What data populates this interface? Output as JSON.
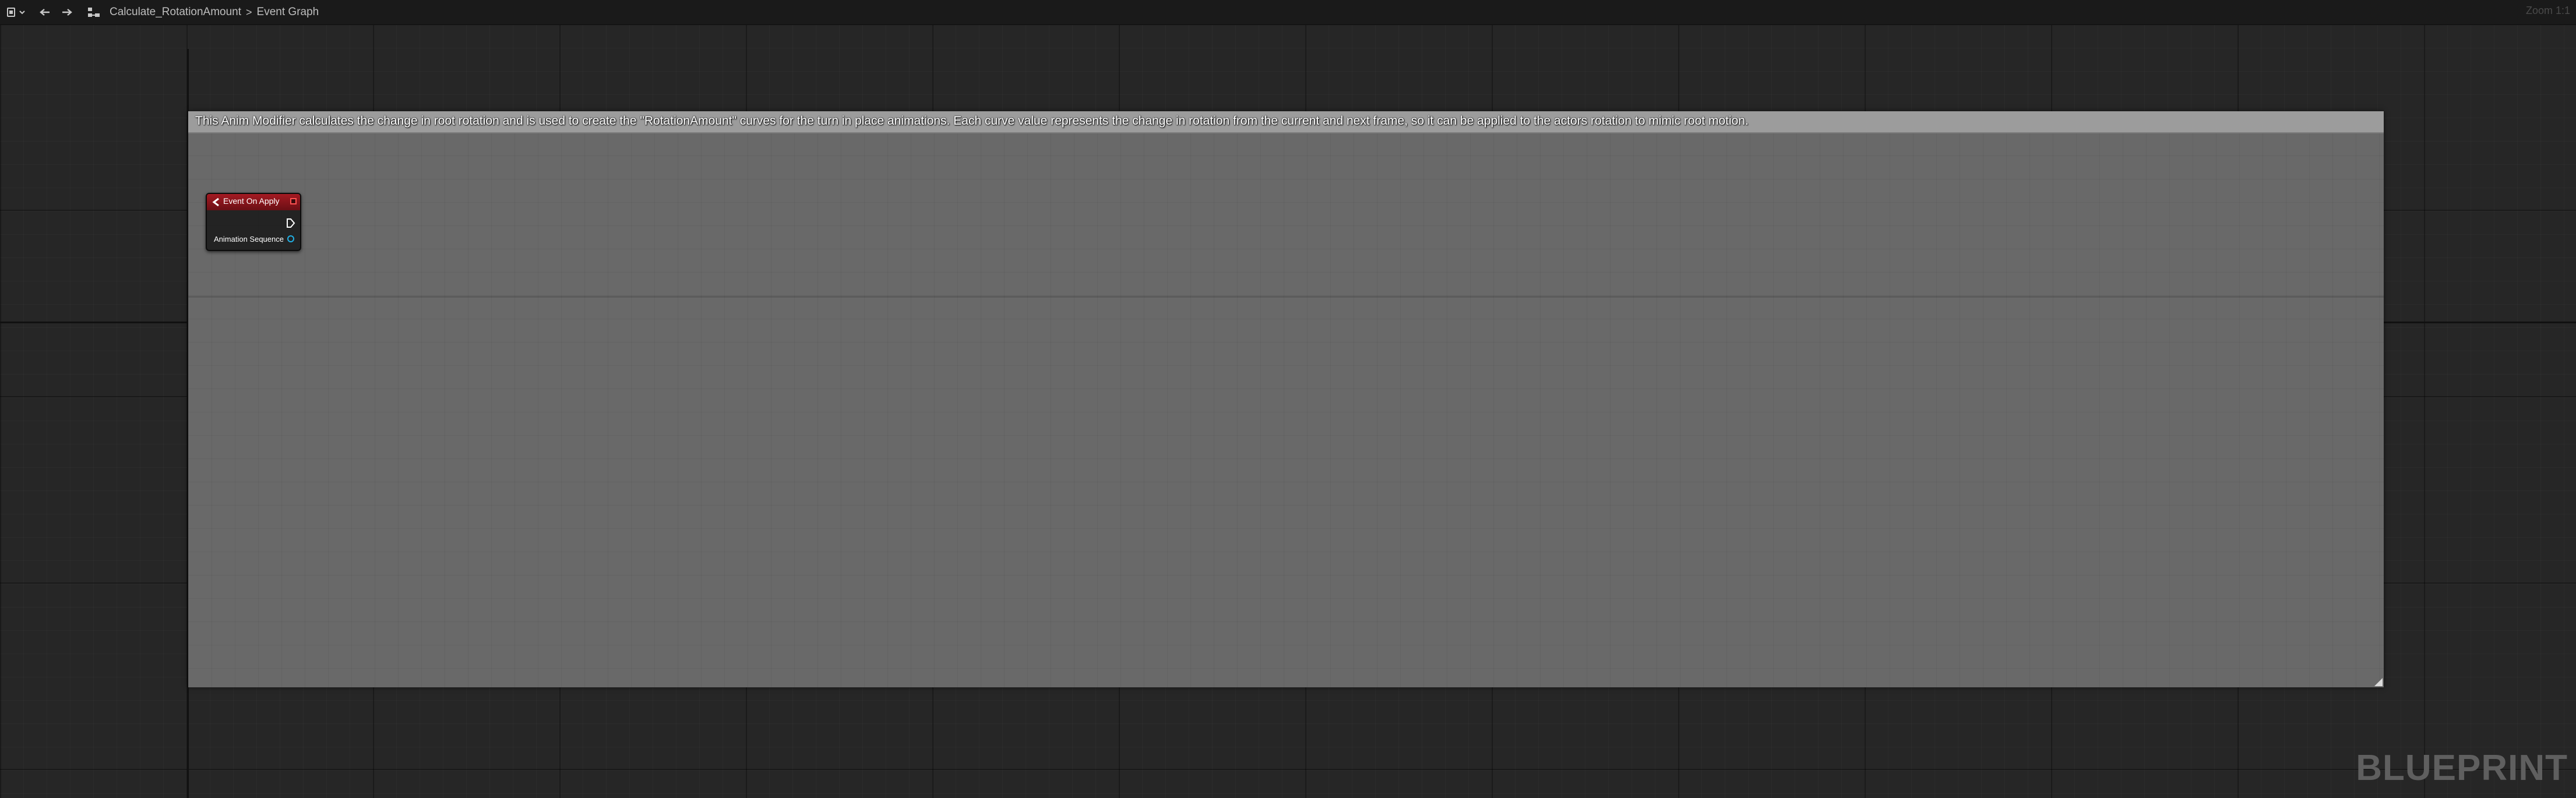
{
  "toolbar": {
    "breadcrumb_graph": "Calculate_RotationAmount",
    "breadcrumb_separator": ">",
    "breadcrumb_current": "Event Graph",
    "zoom_label": "Zoom 1:1",
    "icons": [
      "blueprint-menu-icon",
      "chevron-down-icon",
      "back-arrow-icon",
      "forward-arrow-icon",
      "graph-hierarchy-icon"
    ]
  },
  "comment": {
    "text": "This Anim Modifier calculates the change in root rotation and is used to create the \"RotationAmount\" curves for the turn in place animations. Each curve value represents the change in rotation from the current and next frame, so it can be applied to the actors rotation to mimic root motion.",
    "header_color": "#9c9c9c",
    "body_color": "#6a6a6a"
  },
  "node": {
    "title": "Event On Apply",
    "header_color": "#a41a22",
    "output_pin_label": "Animation Sequence",
    "output_pin_color": "#21b1e6",
    "delegate_pin_color": "#ff5252"
  },
  "watermark": "BLUEPRINT"
}
